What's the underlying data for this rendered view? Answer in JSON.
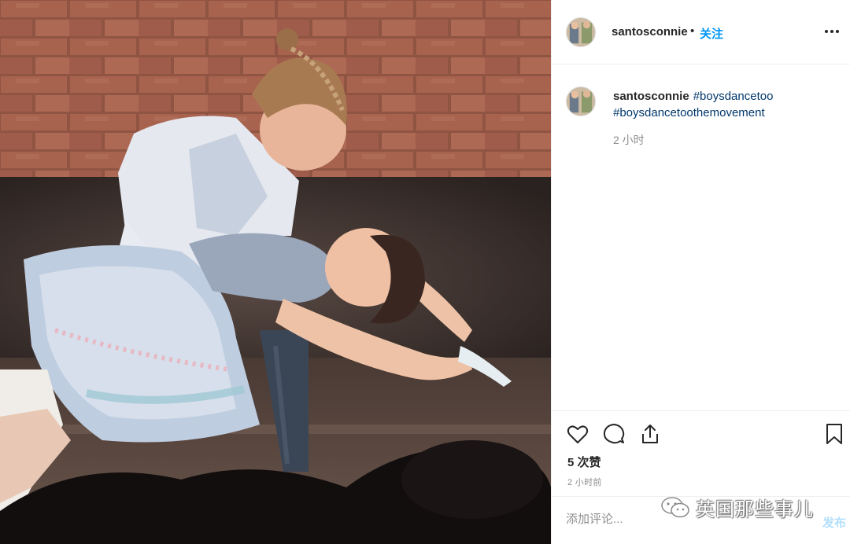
{
  "post": {
    "username": "santosconnie",
    "dot": "•",
    "follow_label": "关注",
    "more_label": "更多选项"
  },
  "caption": {
    "username": "santosconnie",
    "hashtag_1": "#boysdancetoo",
    "hashtag_2": "#boysdancetoothemovement",
    "time_ago": "2 小时"
  },
  "stats": {
    "likes": "5 次赞",
    "posted": "2 小时前"
  },
  "comment": {
    "placeholder": "添加评论...",
    "publish_label": "发布"
  },
  "watermark": {
    "text": "英国那些事儿"
  },
  "icons": {
    "like": "heart-icon",
    "comment": "comment-bubble-icon",
    "share": "share-upload-icon",
    "save": "bookmark-icon",
    "more": "ellipsis-icon"
  },
  "colors": {
    "link_blue": "#0095f6",
    "hashtag": "#00376b",
    "muted": "#8e8e8e",
    "publish_disabled": "#b2dffc",
    "border": "#efefef"
  }
}
